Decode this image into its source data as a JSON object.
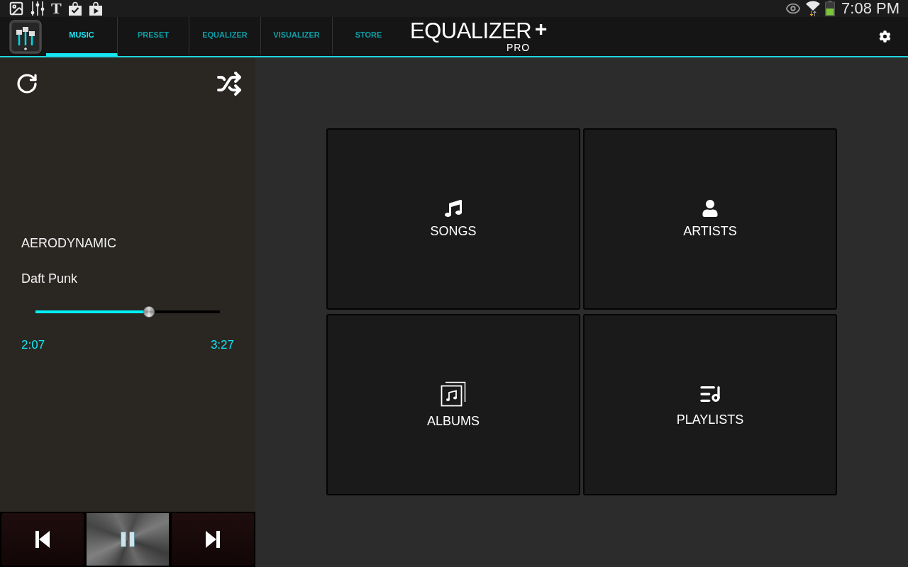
{
  "status_bar": {
    "news_glyph": "T",
    "time": "7:08 PM"
  },
  "app_bar": {
    "tabs": [
      {
        "label": "MUSIC",
        "selected": true
      },
      {
        "label": "PRESET",
        "selected": false
      },
      {
        "label": "EQUALIZER",
        "selected": false
      },
      {
        "label": "VISUALIZER",
        "selected": false
      },
      {
        "label": "STORE",
        "selected": false
      }
    ],
    "logo": {
      "wordmark": "EQUALIZER",
      "mark": "+",
      "edition": "PRO"
    }
  },
  "player": {
    "title": "AERODYNAMIC",
    "artist": "Daft Punk",
    "progress": {
      "level": 0.615
    },
    "elapsed": "2:07",
    "duration": "3:27",
    "controls": [
      {
        "kind": "previous"
      },
      {
        "kind": "pause"
      },
      {
        "kind": "next"
      }
    ]
  },
  "library": {
    "tiles": [
      {
        "kind": "songs",
        "label": "SONGS"
      },
      {
        "kind": "artists",
        "label": "ARTISTS"
      },
      {
        "kind": "albums",
        "label": "ALBUMS"
      },
      {
        "kind": "playlists",
        "label": "PLAYLISTS"
      }
    ]
  }
}
